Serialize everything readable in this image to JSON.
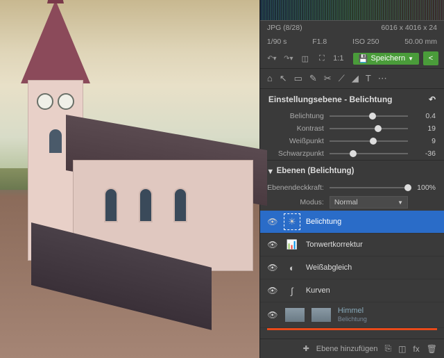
{
  "meta": {
    "format": "JPG",
    "index": "(8/28)",
    "dimensions": "6016 x 4016 x 24",
    "shutter": "1/90 s",
    "aperture": "F1.8",
    "iso": "ISO 250",
    "focal": "50.00 mm"
  },
  "toolbar": {
    "save_label": "Speichern"
  },
  "adjustment": {
    "title": "Einstellungsebene - Belichtung",
    "sliders": [
      {
        "label": "Belichtung",
        "value": "0.4",
        "pos": 55
      },
      {
        "label": "Kontrast",
        "value": "19",
        "pos": 62
      },
      {
        "label": "Weißpunkt",
        "value": "9",
        "pos": 56
      },
      {
        "label": "Schwarzpunkt",
        "value": "-36",
        "pos": 30
      }
    ]
  },
  "layers_panel": {
    "title": "Ebenen (Belichtung)",
    "opacity_label": "Ebenendeckkraft:",
    "opacity_value": "100%",
    "mode_label": "Modus:",
    "mode_value": "Normal",
    "items": [
      {
        "icon": "☀",
        "label": "Belichtung",
        "selected": true
      },
      {
        "icon": "📊",
        "label": "Tonwertkorrektur",
        "selected": false
      },
      {
        "icon": "◐",
        "label": "Weißabgleich",
        "selected": false
      },
      {
        "icon": "∫",
        "label": "Kurven",
        "selected": false
      },
      {
        "icon": "",
        "label": "Himmel",
        "selected": false,
        "thumb": true,
        "sub": "Belichtung"
      }
    ]
  },
  "footer": {
    "add_layer": "Ebene hinzufügen"
  }
}
